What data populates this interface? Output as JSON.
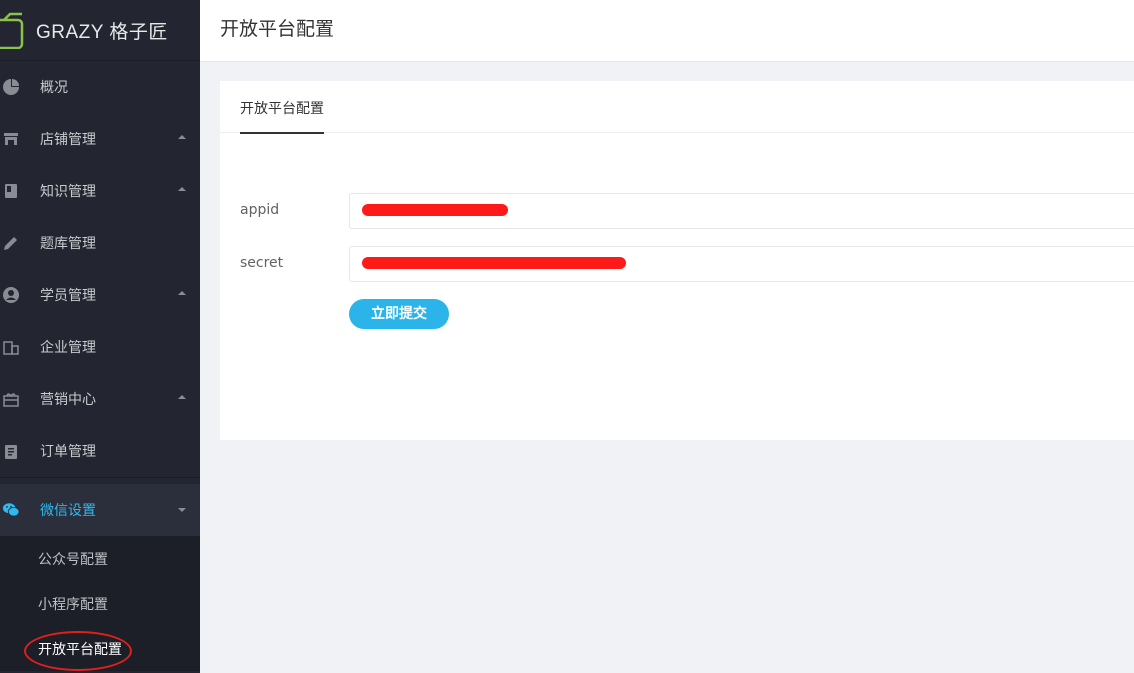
{
  "brand": {
    "name": "GRAZY 格子匠",
    "accent": "#8bc34a"
  },
  "colors": {
    "sidebar_bg": "#232531",
    "active_text": "#2eb9f0",
    "button_bg": "#2bb4ea",
    "annotation": "#e0201b"
  },
  "sidebar": {
    "items": [
      {
        "label": "概况",
        "icon": "pie-chart-icon",
        "expandable": false
      },
      {
        "label": "店铺管理",
        "icon": "store-icon",
        "expandable": true
      },
      {
        "label": "知识管理",
        "icon": "book-icon",
        "expandable": true
      },
      {
        "label": "题库管理",
        "icon": "pencil-icon",
        "expandable": false
      },
      {
        "label": "学员管理",
        "icon": "user-circle-icon",
        "expandable": true
      },
      {
        "label": "企业管理",
        "icon": "building-icon",
        "expandable": false
      },
      {
        "label": "营销中心",
        "icon": "gift-icon",
        "expandable": true
      },
      {
        "label": "订单管理",
        "icon": "clipboard-icon",
        "expandable": false
      }
    ],
    "active_group": {
      "label": "微信设置",
      "icon": "wechat-icon",
      "expanded": true
    },
    "subitems": [
      {
        "label": "公众号配置"
      },
      {
        "label": "小程序配置"
      },
      {
        "label": "开放平台配置",
        "current": true
      }
    ]
  },
  "header": {
    "title": "开放平台配置"
  },
  "card": {
    "tab_label": "开放平台配置",
    "form": {
      "appid_label": "appid",
      "secret_label": "secret",
      "submit_label": "立即提交"
    }
  }
}
